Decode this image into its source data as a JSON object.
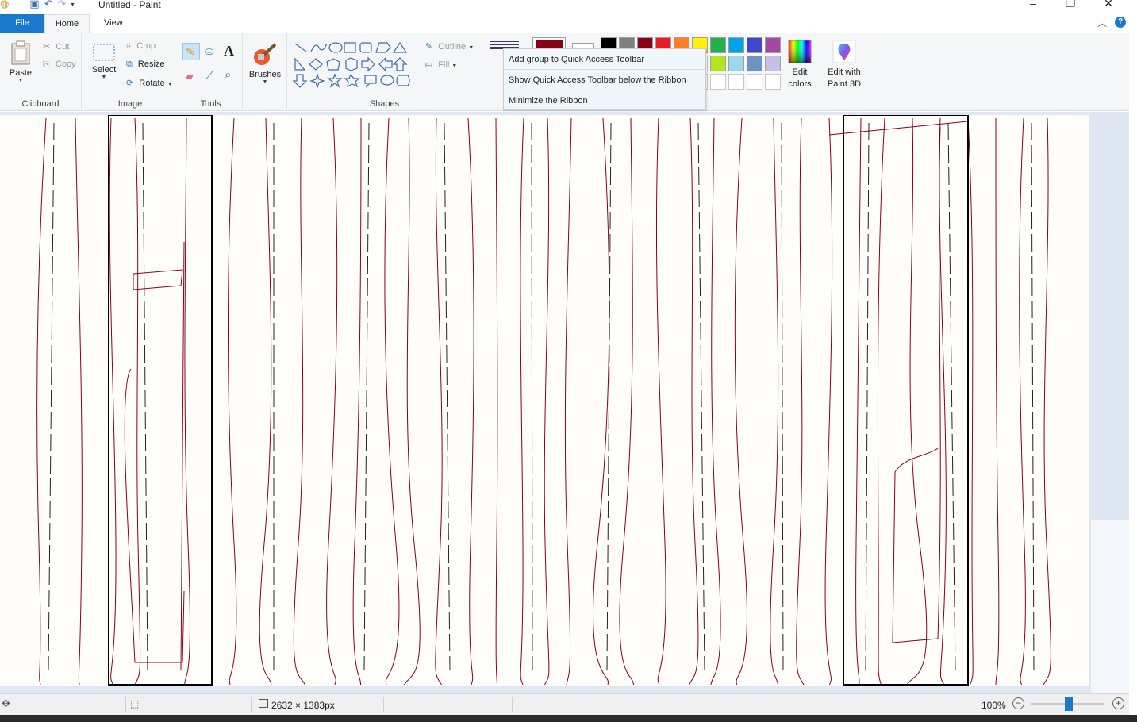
{
  "window": {
    "title": "Untitled - Paint",
    "minimize": "–",
    "restore": "❐",
    "close": "✕"
  },
  "tabs": {
    "file": "File",
    "home": "Home",
    "view": "View"
  },
  "clipboard": {
    "paste": "Paste",
    "cut": "Cut",
    "copy": "Copy",
    "label": "Clipboard"
  },
  "image": {
    "select": "Select",
    "crop": "Crop",
    "resize": "Resize",
    "rotate": "Rotate",
    "label": "Image"
  },
  "tools": {
    "label": "Tools"
  },
  "brushes": {
    "label": "Brushes"
  },
  "shapes": {
    "outline": "Outline",
    "fill": "Fill",
    "label": "Shapes"
  },
  "colors": {
    "edit": "Edit colors",
    "paint3d": "Edit with Paint 3D",
    "color1": "#880015",
    "color2": "#ffffff",
    "palette_row1": [
      "#000000",
      "#7f7f7f",
      "#880015",
      "#ed1c24",
      "#ff7f27",
      "#fff200",
      "#22b14c",
      "#00a2e8",
      "#3f48cc",
      "#a349a4"
    ],
    "palette_row2": [
      "#b5e61d",
      "#99d9ea",
      "#7092be",
      "#c8bfe7"
    ]
  },
  "context_menu": {
    "item1": "Add group to Quick Access Toolbar",
    "item2": "Show Quick Access Toolbar below the Ribbon",
    "item3": "Minimize the Ribbon"
  },
  "status": {
    "image_size": "2632 × 1383px",
    "zoom": "100%"
  },
  "accent": "#1979ca",
  "stroke_color": "#880015"
}
